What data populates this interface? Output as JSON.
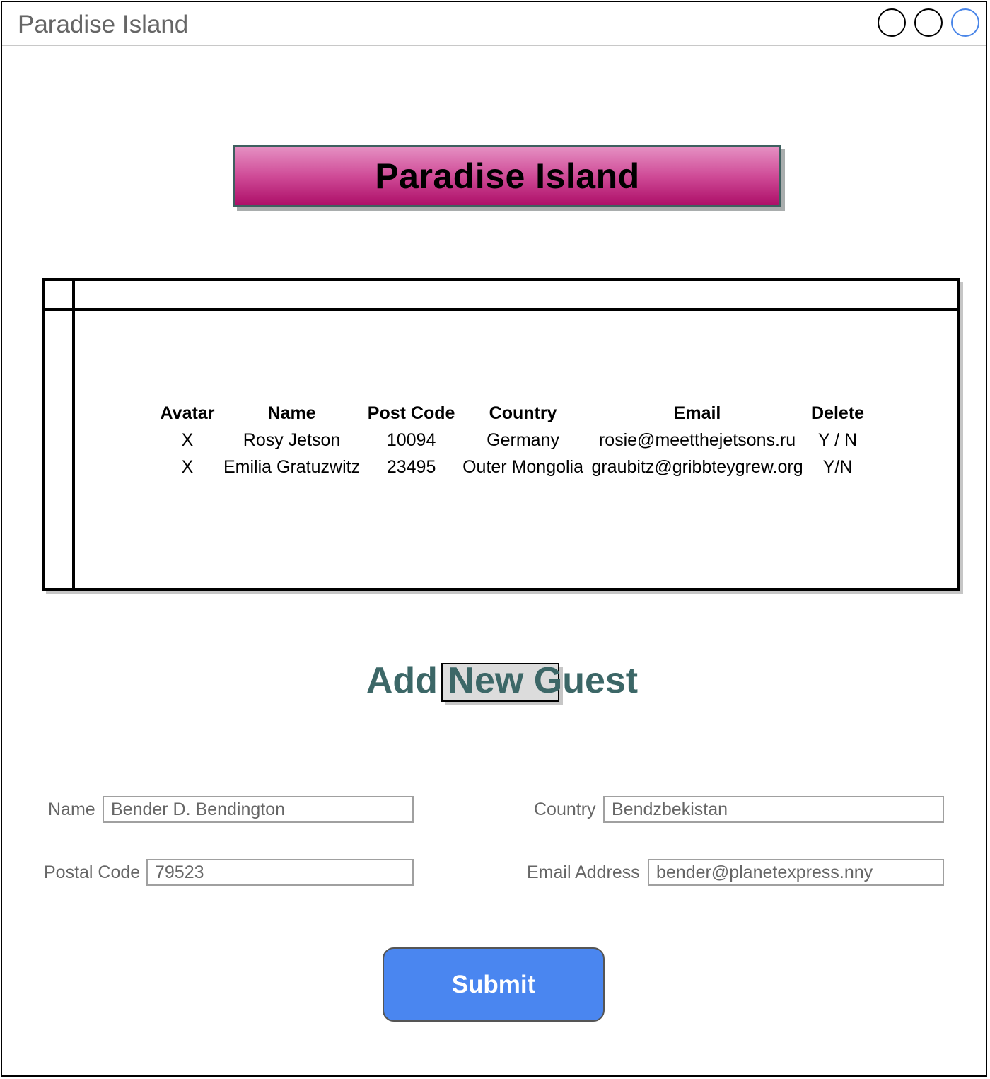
{
  "window": {
    "title": "Paradise Island",
    "controls": [
      "circle-button",
      "circle-button",
      "circle-button"
    ]
  },
  "banner": {
    "title": "Paradise Island"
  },
  "guests_table": {
    "headers": {
      "avatar": "Avatar",
      "name": "Name",
      "post_code": "Post Code",
      "country": "Country",
      "email": "Email",
      "delete": "Delete"
    },
    "rows": [
      {
        "avatar": "X",
        "name": "Rosy Jetson",
        "post_code": "10094",
        "country": "Germany",
        "email": "rosie@meetthejetsons.ru",
        "delete": "Y / N"
      },
      {
        "avatar": "X",
        "name": "Emilia Gratuzwitz",
        "post_code": "23495",
        "country": "Outer Mongolia",
        "email": "graubitz@gribbteygrew.org",
        "delete": "Y/N"
      }
    ]
  },
  "form": {
    "heading": "Add New Guest",
    "name_label": "Name",
    "name_value": "Bender D. Bendington",
    "country_label": "Country",
    "country_value": "Bendzbekistan",
    "postal_label": "Postal Code",
    "postal_value": "79523",
    "email_label": "Email Address",
    "email_value": "bender@planetexpress.nny",
    "submit_label": "Submit"
  },
  "colors": {
    "banner_top": "#e58fc2",
    "banner_bottom": "#ad0f68",
    "heading": "#3c6767",
    "submit": "#4a86f0",
    "maximize_ring": "#4a86e8"
  }
}
